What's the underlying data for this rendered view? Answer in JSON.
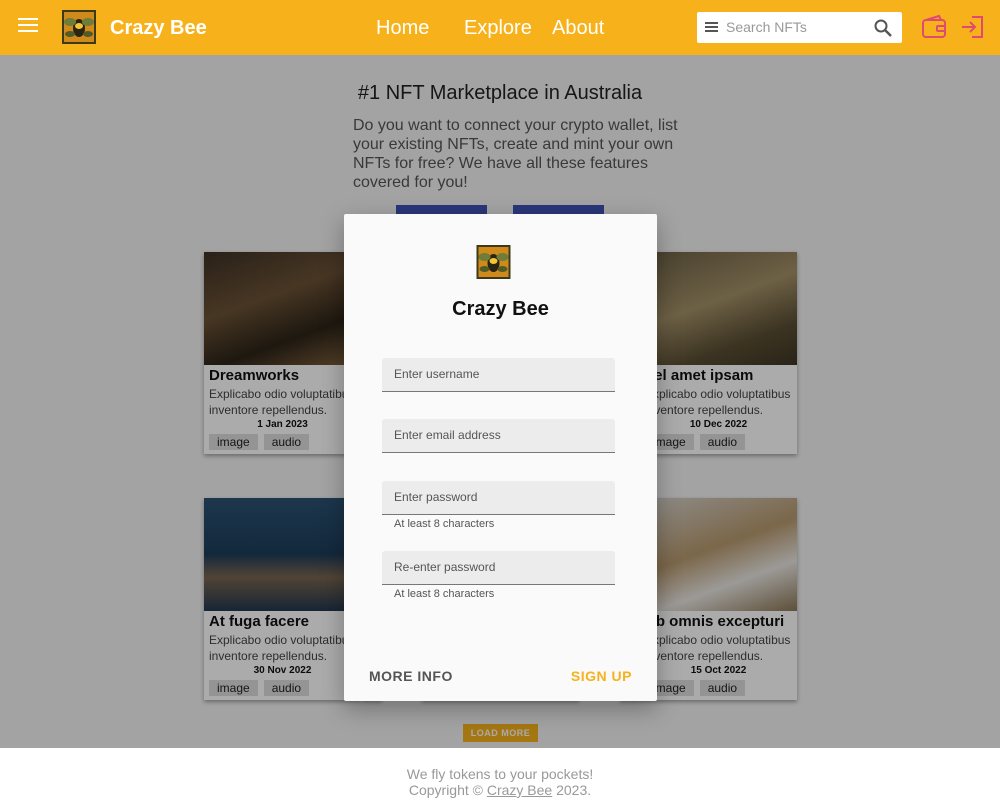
{
  "header": {
    "brand": "Crazy Bee",
    "nav": [
      "Home",
      "Explore",
      "About"
    ],
    "search_placeholder": "Search NFTs",
    "accent_color": "#f7b21b",
    "icons": [
      "menu-icon",
      "search-icon",
      "wallet-icon",
      "login-icon"
    ]
  },
  "hero": {
    "title": "#1 NFT Marketplace in Australia",
    "text": "Do you want to connect your crypto wallet, list your existing NFTs, create and mint your own NFTs for free? We have all these features covered for you!",
    "button_color": "#3f51b5"
  },
  "cards": [
    {
      "title": "Dreamworks",
      "desc_1": "Explicabo odio voluptatibus",
      "desc_2": "inventore repellendus.",
      "date": "1 Jan 2023",
      "tags": [
        "image",
        "audio"
      ]
    },
    {
      "title": "Vel amet ipsam",
      "desc_1": "Explicabo odio voluptatibus",
      "desc_2": "inventore repellendus.",
      "date": "10 Dec 2022",
      "tags": [
        "image",
        "audio"
      ]
    },
    {
      "title": "At fuga facere",
      "desc_1": "Explicabo odio voluptatibus",
      "desc_2": "inventore repellendus.",
      "date": "30 Nov 2022",
      "tags": [
        "image",
        "audio"
      ]
    },
    {
      "title": "Ab omnis excepturi",
      "desc_1": "Explicabo odio voluptatibus",
      "desc_2": "inventore repellendus.",
      "date": "15 Oct 2022",
      "tags": [
        "image",
        "audio"
      ]
    }
  ],
  "load_more": "LOAD MORE",
  "footer": {
    "tagline": "We fly tokens to your pockets!",
    "copyright_prefix": "Copyright ©",
    "link": "Crazy Bee",
    "year": "2023."
  },
  "dialog": {
    "title": "Crazy Bee",
    "fields": [
      {
        "label": "Enter username"
      },
      {
        "label": "Enter email address"
      },
      {
        "label": "Enter password",
        "hint": "At least 8 characters"
      },
      {
        "label": "Re-enter password",
        "hint": "At least 8 characters"
      }
    ],
    "more_info": "MORE INFO",
    "sign_up": "SIGN UP"
  }
}
